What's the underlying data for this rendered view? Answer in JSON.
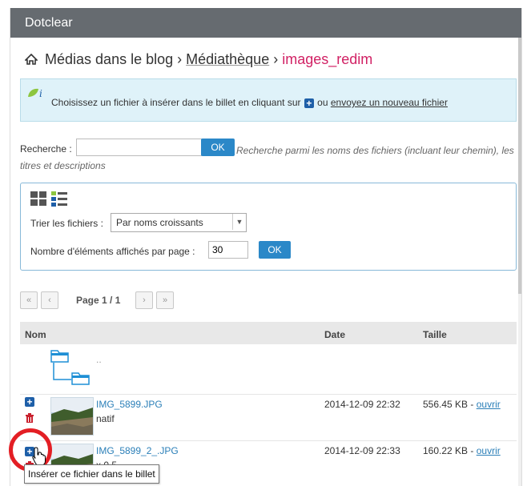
{
  "app": {
    "title": "Dotclear"
  },
  "breadcrumb": {
    "part1": "Médias dans le blog",
    "sep1": " › ",
    "part2": "Médiathèque",
    "sep2": " › ",
    "current": "images_redim"
  },
  "info": {
    "before": "Choisissez un fichier à insérer dans le billet en cliquant sur ",
    "middle": " ou ",
    "link": "envoyez un nouveau fichier"
  },
  "search": {
    "label": "Recherche :",
    "value": "",
    "ok": "OK",
    "help": "Recherche parmi les noms des fichiers (incluant leur chemin), les titres et descriptions"
  },
  "filters": {
    "sort_label": "Trier les fichiers :",
    "sort_value": "Par noms croissants",
    "per_page_label": "Nombre d'éléments affichés par page :",
    "per_page_value": "30",
    "ok": "OK"
  },
  "pager": {
    "first": "«",
    "prev": "‹",
    "label": "Page 1 / 1",
    "next": "›",
    "last": "»"
  },
  "table": {
    "headers": {
      "name": "Nom",
      "date": "Date",
      "size": "Taille"
    },
    "parent": "..",
    "rows": [
      {
        "name": "IMG_5899.JPG",
        "sub": "natif",
        "date": "2014-12-09 22:32",
        "size": "556.45 KB - ",
        "open": "ouvrir"
      },
      {
        "name": "IMG_5899_2_.JPG",
        "sub": "x 0.5",
        "date": "2014-12-09 22:33",
        "size": "160.22 KB - ",
        "open": "ouvrir"
      }
    ]
  },
  "tooltip": "Insérer ce fichier dans le billet",
  "colors": {
    "header": "#666b70",
    "accent": "#2b88c8",
    "current": "#d12164",
    "highlight": "#e31e24"
  }
}
